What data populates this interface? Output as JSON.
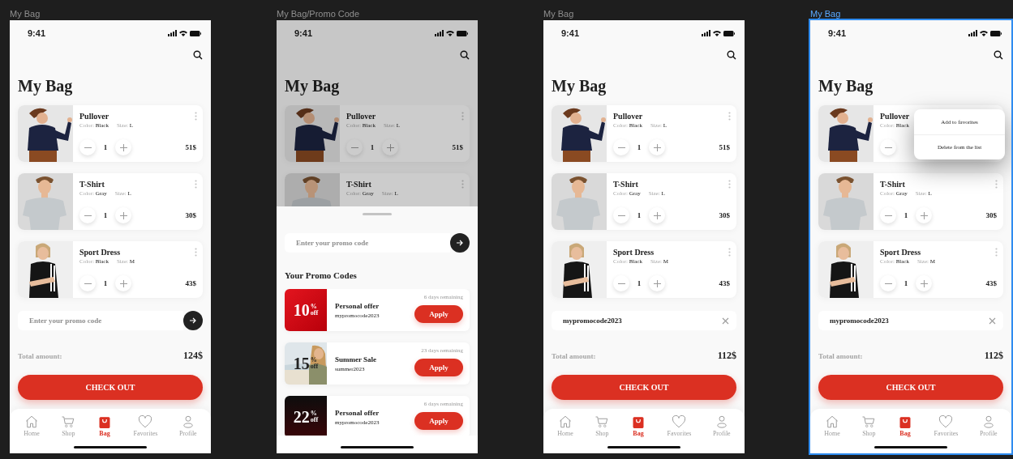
{
  "canvas": {
    "frames": [
      {
        "label": "My Bag",
        "selected": false,
        "screen": {
          "time": "9:41",
          "title": "My Bag",
          "dimmed": false,
          "items": [
            {
              "name": "Pullover",
              "attributes": [
                {
                  "label": "Color:",
                  "value": "Black"
                },
                {
                  "label": "Size:",
                  "value": "L"
                }
              ],
              "stepper": true,
              "quantity": "1",
              "price": "51$",
              "more": true
            },
            {
              "name": "T-Shirt",
              "attributes": [
                {
                  "label": "Color:",
                  "value": "Gray"
                },
                {
                  "label": "Size:",
                  "value": "L"
                }
              ],
              "stepper": true,
              "quantity": "1",
              "price": "30$",
              "more": true
            },
            {
              "name": "Sport Dress",
              "attributes": [
                {
                  "label": "Color:",
                  "value": "Black"
                },
                {
                  "label": "Size:",
                  "value": "M"
                }
              ],
              "stepper": true,
              "quantity": "1",
              "price": "43$",
              "more": true
            }
          ],
          "promo": {
            "kind": "input",
            "placeholder": "Enter your promo code"
          },
          "total": {
            "label": "Total amount:",
            "value": "124$"
          },
          "checkout": "CHECK OUT",
          "nav": [
            {
              "label": "Home",
              "selected": false
            },
            {
              "label": "Shop",
              "selected": false
            },
            {
              "label": "Bag",
              "selected": true
            },
            {
              "label": "Favorites",
              "selected": false
            },
            {
              "label": "Profile",
              "selected": false
            }
          ]
        }
      },
      {
        "label": "My Bag/Promo Code",
        "selected": false,
        "screen": {
          "time": "9:41",
          "title": "My Bag",
          "dimmed": true,
          "items": [
            {
              "name": "Pullover",
              "attributes": [
                {
                  "label": "Color:",
                  "value": "Black"
                },
                {
                  "label": "Size:",
                  "value": "L"
                }
              ],
              "stepper": true,
              "quantity": "1",
              "price": "51$",
              "more": true
            },
            {
              "name": "T-Shirt",
              "attributes": [
                {
                  "label": "Color:",
                  "value": "Gray"
                },
                {
                  "label": "Size:",
                  "value": "L"
                }
              ],
              "stepper": false,
              "more": true
            }
          ],
          "sheet": {
            "placeholder": "Enter your promo code",
            "heading": "Your Promo Codes",
            "codes": [
              {
                "kind": "solid",
                "amount": "10",
                "percent": "%",
                "off": "off",
                "title": "Personal offer",
                "code": "mypromocode2023",
                "remaining": "6 days remaining",
                "action": "Apply"
              },
              {
                "amount": "15",
                "percent": "%",
                "off": "off",
                "title": "Summer Sale",
                "code": "summer2023",
                "remaining": "23 days remaining",
                "action": "Apply"
              },
              {
                "kind": "dark",
                "amount": "22",
                "percent": "%",
                "off": "off",
                "title": "Personal offer",
                "code": "mypromocode2023",
                "remaining": "6 days remaining",
                "action": "Apply"
              }
            ]
          }
        }
      },
      {
        "label": "My Bag",
        "selected": false,
        "screen": {
          "time": "9:41",
          "title": "My Bag",
          "dimmed": false,
          "items": [
            {
              "name": "Pullover",
              "attributes": [
                {
                  "label": "Color:",
                  "value": "Black"
                },
                {
                  "label": "Size:",
                  "value": "L"
                }
              ],
              "stepper": true,
              "quantity": "1",
              "price": "51$",
              "more": true
            },
            {
              "name": "T-Shirt",
              "attributes": [
                {
                  "label": "Color:",
                  "value": "Gray"
                },
                {
                  "label": "Size:",
                  "value": "L"
                }
              ],
              "stepper": true,
              "quantity": "1",
              "price": "30$",
              "more": true
            },
            {
              "name": "Sport Dress",
              "attributes": [
                {
                  "label": "Color:",
                  "value": "Black"
                },
                {
                  "label": "Size:",
                  "value": "M"
                }
              ],
              "stepper": true,
              "quantity": "1",
              "price": "43$",
              "more": true
            }
          ],
          "promo": {
            "kind": "applied",
            "value": "mypromocode2023"
          },
          "total": {
            "label": "Total amount:",
            "value": "112$"
          },
          "checkout": "CHECK OUT",
          "nav": [
            {
              "label": "Home",
              "selected": false
            },
            {
              "label": "Shop",
              "selected": false
            },
            {
              "label": "Bag",
              "selected": true
            },
            {
              "label": "Favorites",
              "selected": false
            },
            {
              "label": "Profile",
              "selected": false
            }
          ]
        }
      },
      {
        "label": "My Bag",
        "selected": true,
        "screen": {
          "time": "9:41",
          "title": "My Bag",
          "dimmed": false,
          "items": [
            {
              "name": "Pullover",
              "attributes": [
                {
                  "label": "Color:",
                  "value": "Black"
                }
              ],
              "stepper": true,
              "more": false
            },
            {
              "name": "T-Shirt",
              "attributes": [
                {
                  "label": "Color:",
                  "value": "Gray"
                },
                {
                  "label": "Size:",
                  "value": "L"
                }
              ],
              "stepper": true,
              "quantity": "1",
              "price": "30$",
              "more": true
            },
            {
              "name": "Sport Dress",
              "attributes": [
                {
                  "label": "Color:",
                  "value": "Black"
                },
                {
                  "label": "Size:",
                  "value": "M"
                }
              ],
              "stepper": true,
              "quantity": "1",
              "price": "43$",
              "more": true
            }
          ],
          "promo": {
            "kind": "applied",
            "value": "mypromocode2023"
          },
          "total": {
            "label": "Total amount:",
            "value": "112$"
          },
          "checkout": "CHECK OUT",
          "nav": [
            {
              "label": "Home",
              "selected": false
            },
            {
              "label": "Shop",
              "selected": false
            },
            {
              "label": "Bag",
              "selected": true
            },
            {
              "label": "Favorites",
              "selected": false
            },
            {
              "label": "Profile",
              "selected": false
            }
          ],
          "menu": [
            {
              "label": "Add to favorites"
            },
            {
              "label": "Delete from the list"
            }
          ]
        }
      }
    ]
  }
}
